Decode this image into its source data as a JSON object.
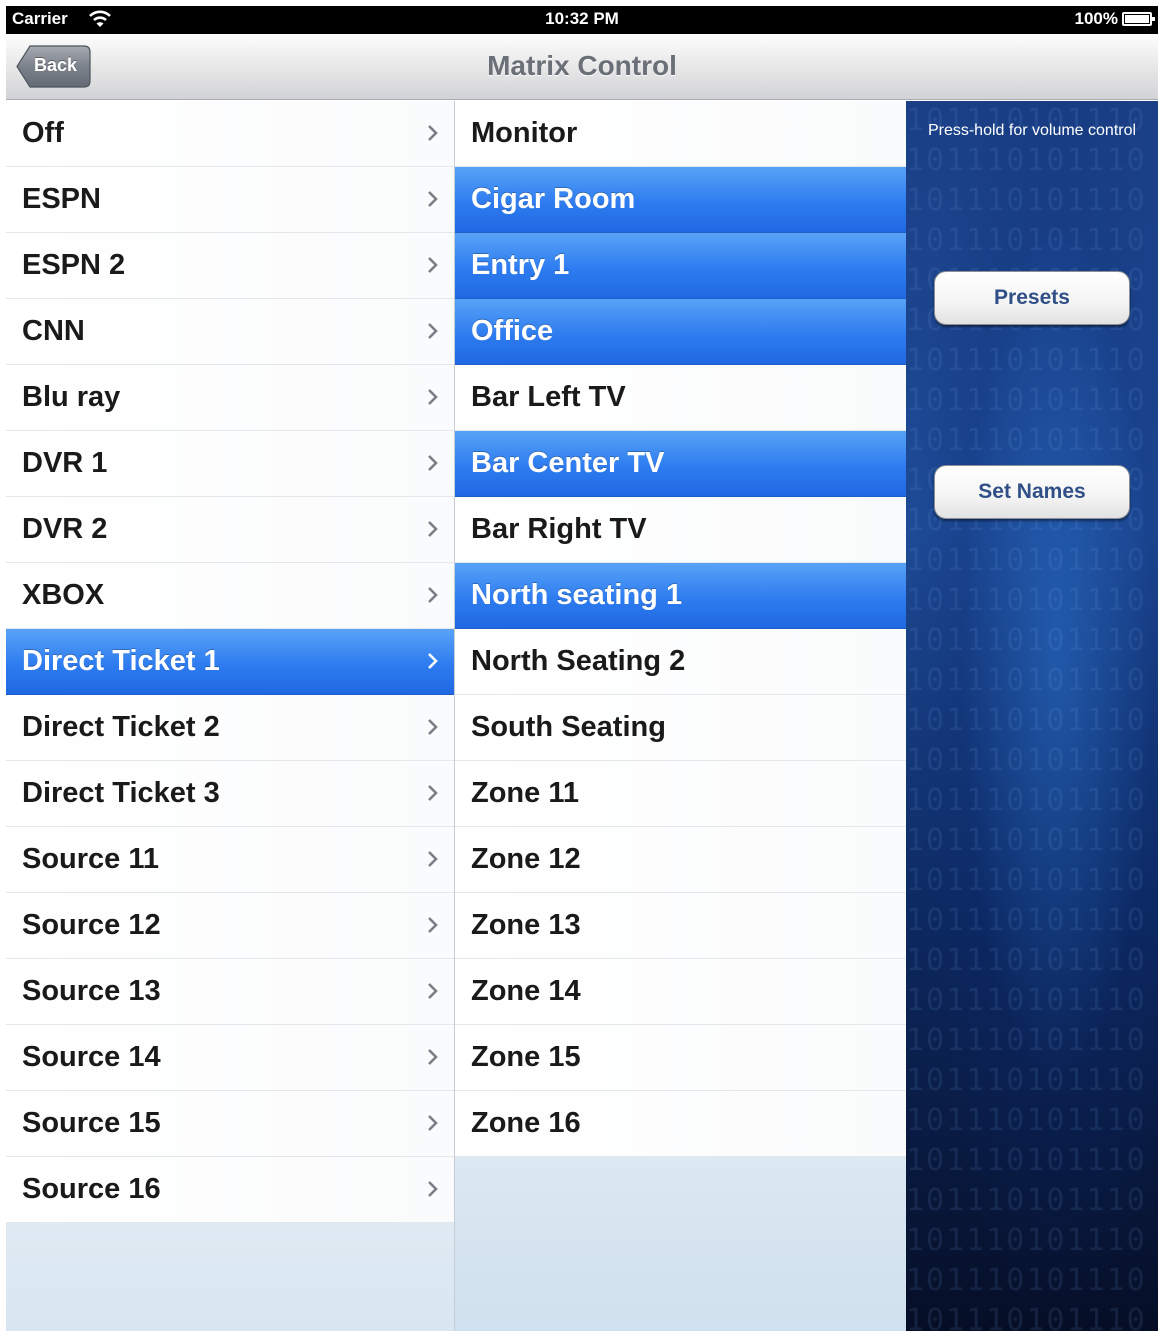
{
  "status_bar": {
    "carrier": "Carrier",
    "time": "10:32 PM",
    "battery": "100%"
  },
  "nav": {
    "back_label": "Back",
    "title": "Matrix Control"
  },
  "sources": [
    {
      "label": "Off",
      "selected": false
    },
    {
      "label": "ESPN",
      "selected": false
    },
    {
      "label": "ESPN 2",
      "selected": false
    },
    {
      "label": "CNN",
      "selected": false
    },
    {
      "label": "Blu ray",
      "selected": false
    },
    {
      "label": "DVR 1",
      "selected": false
    },
    {
      "label": "DVR 2",
      "selected": false
    },
    {
      "label": "XBOX",
      "selected": false
    },
    {
      "label": "Direct Ticket 1",
      "selected": true
    },
    {
      "label": "Direct Ticket 2",
      "selected": false
    },
    {
      "label": "Direct Ticket 3",
      "selected": false
    },
    {
      "label": "Source 11",
      "selected": false
    },
    {
      "label": "Source 12",
      "selected": false
    },
    {
      "label": "Source 13",
      "selected": false
    },
    {
      "label": "Source 14",
      "selected": false
    },
    {
      "label": "Source 15",
      "selected": false
    },
    {
      "label": "Source 16",
      "selected": false
    }
  ],
  "zones": [
    {
      "label": "Monitor",
      "selected": false
    },
    {
      "label": "Cigar Room",
      "selected": true
    },
    {
      "label": "Entry 1",
      "selected": true
    },
    {
      "label": "Office",
      "selected": true
    },
    {
      "label": "Bar Left TV",
      "selected": false
    },
    {
      "label": "Bar Center TV",
      "selected": true
    },
    {
      "label": "Bar Right TV",
      "selected": false
    },
    {
      "label": "North seating 1",
      "selected": true
    },
    {
      "label": "North Seating 2",
      "selected": false
    },
    {
      "label": "South Seating",
      "selected": false
    },
    {
      "label": "Zone 11",
      "selected": false
    },
    {
      "label": "Zone 12",
      "selected": false
    },
    {
      "label": "Zone 13",
      "selected": false
    },
    {
      "label": "Zone 14",
      "selected": false
    },
    {
      "label": "Zone 15",
      "selected": false
    },
    {
      "label": "Zone 16",
      "selected": false
    }
  ],
  "right_panel": {
    "hint": "Press-hold for volume control",
    "presets_label": "Presets",
    "set_names_label": "Set Names"
  },
  "colors": {
    "selected_blue": "#2e7cf0",
    "panel_blue": "#1a3f86",
    "button_text": "#2f4f86"
  },
  "icons": [
    "wifi-icon",
    "battery-icon",
    "back-arrow-icon",
    "chevron-right-icon"
  ]
}
